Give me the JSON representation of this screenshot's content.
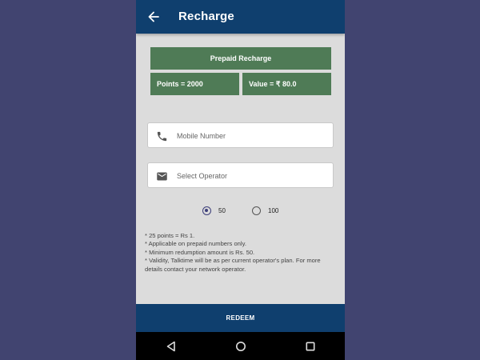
{
  "appbar": {
    "title": "Recharge",
    "back_icon": "arrow-left-icon"
  },
  "plan": {
    "title": "Prepaid Recharge",
    "points": "Points = 2000",
    "value": "Value = ₹ 80.0",
    "color": "#4f7b56"
  },
  "form": {
    "mobile_placeholder": "Mobile Number",
    "mobile_icon": "phone-icon",
    "operator_placeholder": "Select Operator",
    "operator_icon": "mail-icon"
  },
  "amounts": [
    {
      "label": "50",
      "selected": true
    },
    {
      "label": "100",
      "selected": false
    }
  ],
  "notes": [
    "* 25 points = Rs 1.",
    "* Applicable on prepaid numbers only.",
    "* Minimum redumption amount is Rs. 50.",
    "* Validity, Talktime will be as per current operator's plan. For more details contact your network operator."
  ],
  "redeem_label": "REDEEM",
  "colors": {
    "primary": "#0f3f6e",
    "background": "#414470"
  }
}
